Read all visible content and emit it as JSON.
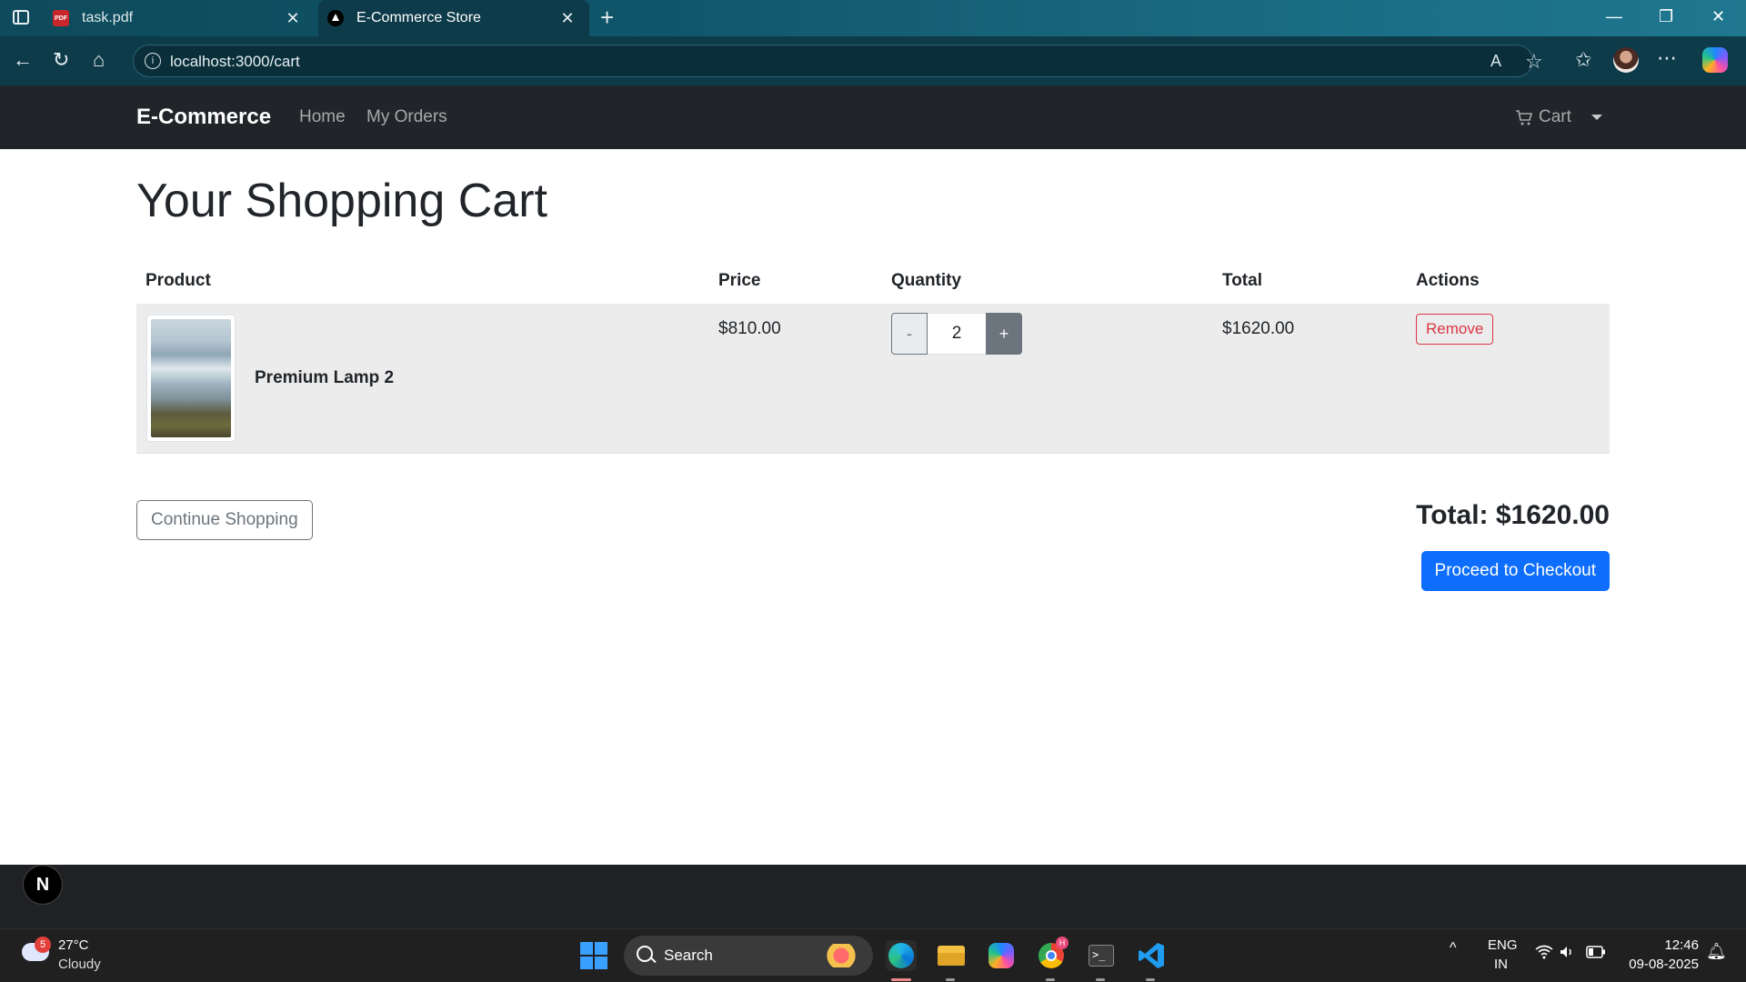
{
  "browser": {
    "tabs": [
      {
        "title": "task.pdf",
        "icon": "pdf-icon"
      },
      {
        "title": "E-Commerce Store",
        "icon": "nextjs-icon",
        "active": true
      }
    ],
    "url": "localhost:3000/cart"
  },
  "navbar": {
    "brand": "E-Commerce",
    "links": [
      "Home",
      "My Orders"
    ],
    "cart_label": "Cart"
  },
  "page": {
    "title": "Your Shopping Cart",
    "table": {
      "headers": [
        "Product",
        "Price",
        "Quantity",
        "Total",
        "Actions"
      ],
      "rows": [
        {
          "name": "Premium Lamp 2",
          "price": "$810.00",
          "quantity": "2",
          "total": "$1620.00",
          "action": "Remove"
        }
      ]
    },
    "qty_minus": "-",
    "qty_plus": "+",
    "continue_label": "Continue Shopping",
    "grand_total": "Total: $1620.00",
    "checkout_label": "Proceed to Checkout"
  },
  "dev_badge": "N",
  "taskbar": {
    "weather_temp": "27°C",
    "weather_desc": "Cloudy",
    "weather_badge": "5",
    "search_placeholder": "Search",
    "lang_top": "ENG",
    "lang_bottom": "IN",
    "time": "12:46",
    "date": "09-08-2025"
  },
  "colors": {
    "navbar_bg": "#212529",
    "primary": "#0d6efd",
    "danger": "#dc3545",
    "secondary": "#6c757d",
    "row_bg": "#ececec"
  }
}
